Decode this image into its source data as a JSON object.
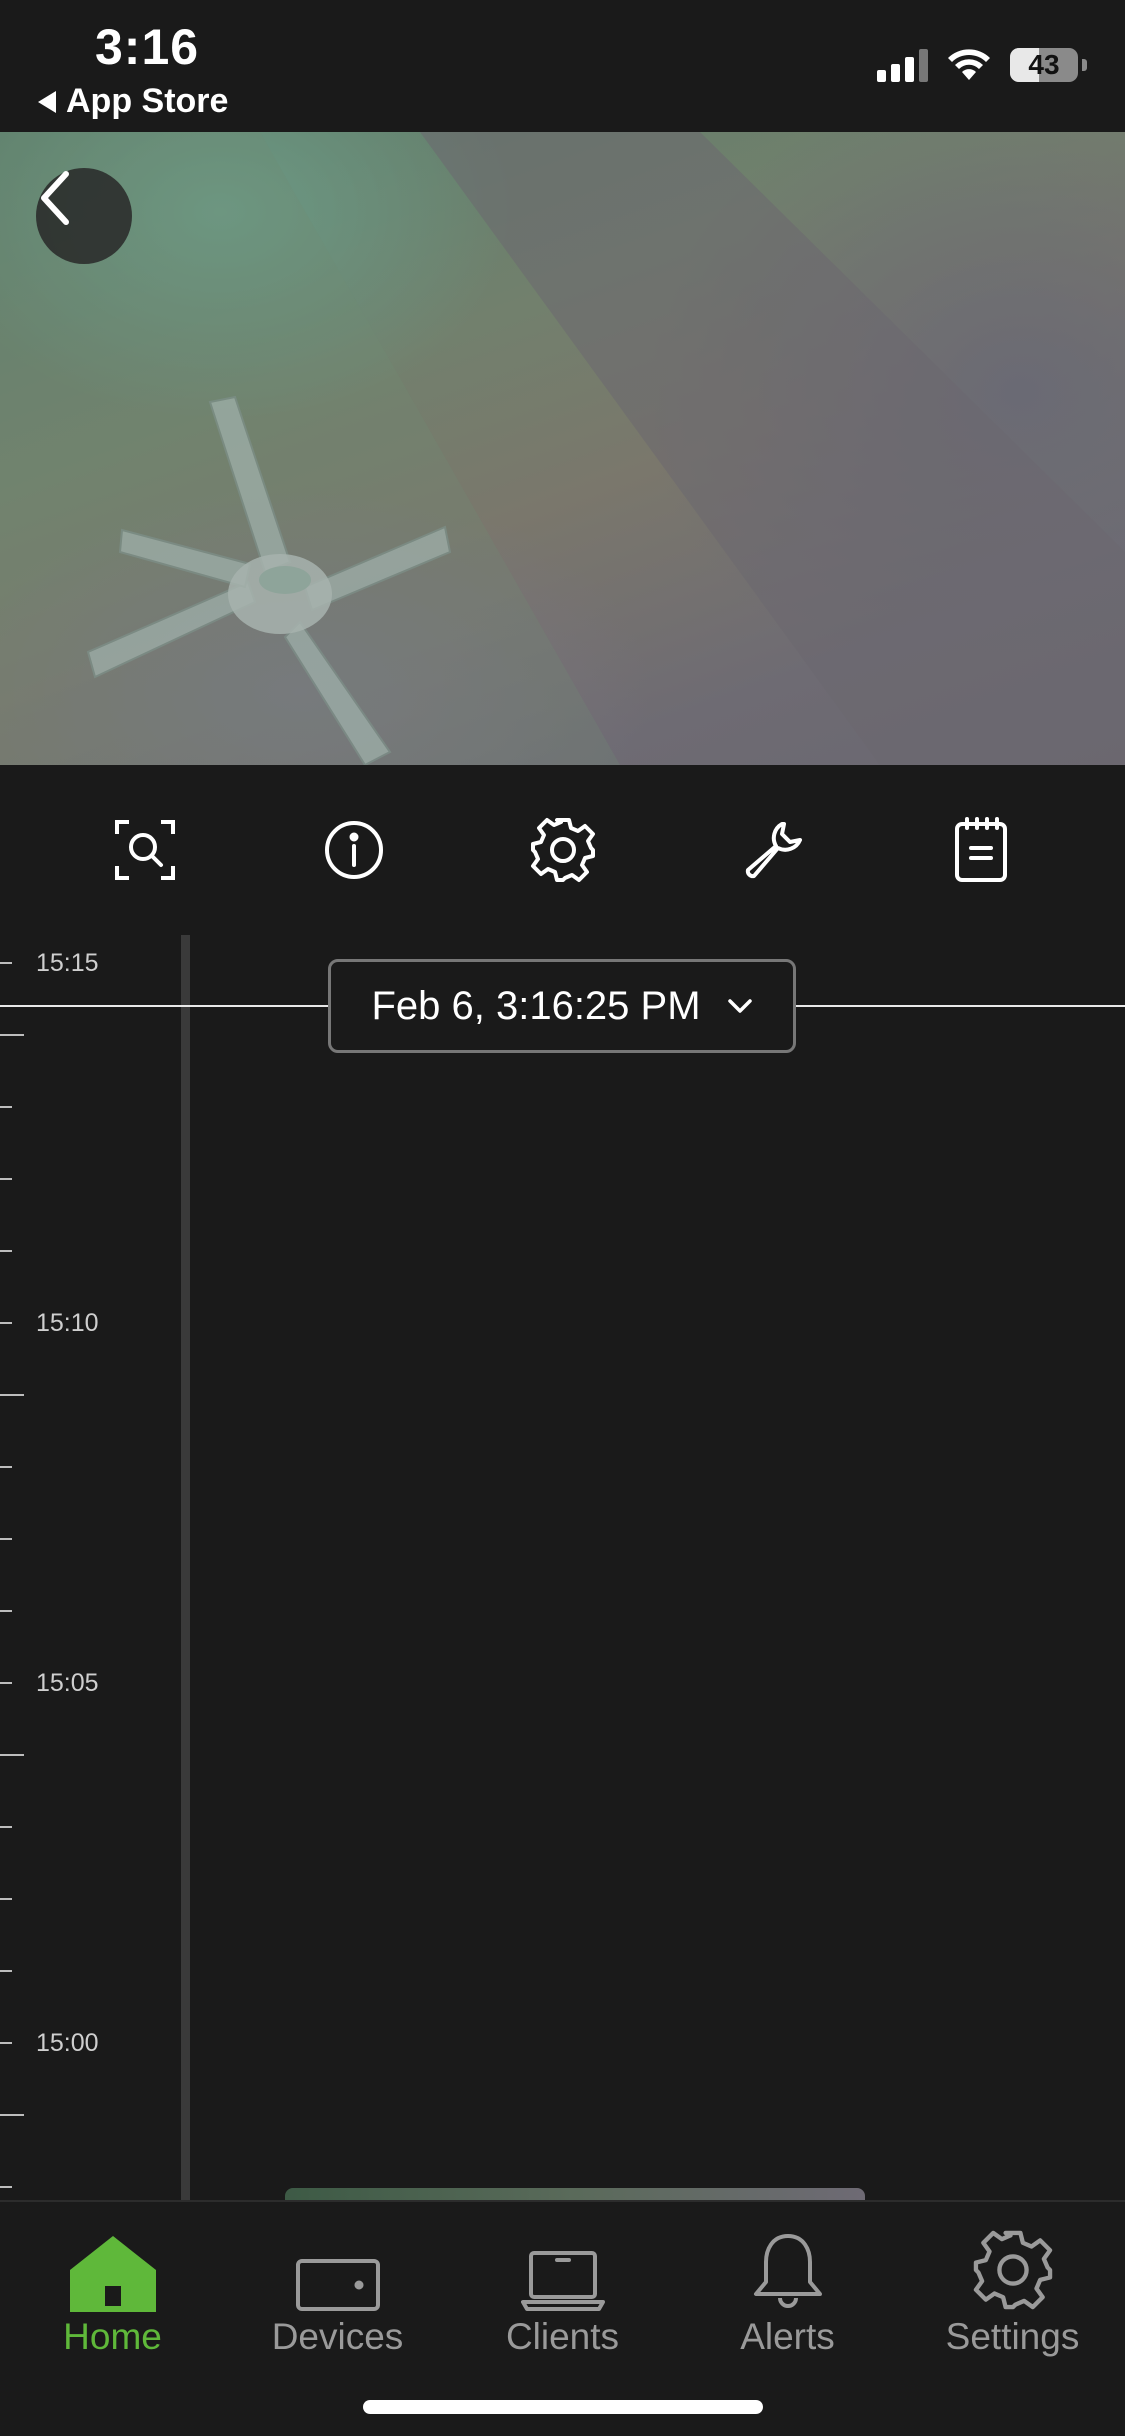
{
  "status_bar": {
    "time": "3:16",
    "back_app": "App Store",
    "battery": "43",
    "battery_level": 0.43
  },
  "toolbar": {
    "icons": [
      "zoom-icon",
      "info-icon",
      "gear-icon",
      "wrench-icon",
      "notepad-icon"
    ]
  },
  "timeline": {
    "selected_time": "Feb 6, 3:16:25 PM",
    "labels": [
      "15:15",
      "15:10",
      "15:05",
      "15:00"
    ]
  },
  "tabbar": {
    "tabs": [
      {
        "label": "Home",
        "icon": "home-icon",
        "active": true
      },
      {
        "label": "Devices",
        "icon": "device-icon",
        "active": false
      },
      {
        "label": "Clients",
        "icon": "laptop-icon",
        "active": false
      },
      {
        "label": "Alerts",
        "icon": "bell-icon",
        "active": false
      },
      {
        "label": "Settings",
        "icon": "gear-icon",
        "active": false
      }
    ]
  },
  "colors": {
    "accent": "#5fb83a",
    "background": "#1a1a1a",
    "inactive": "#9a9a9a"
  }
}
